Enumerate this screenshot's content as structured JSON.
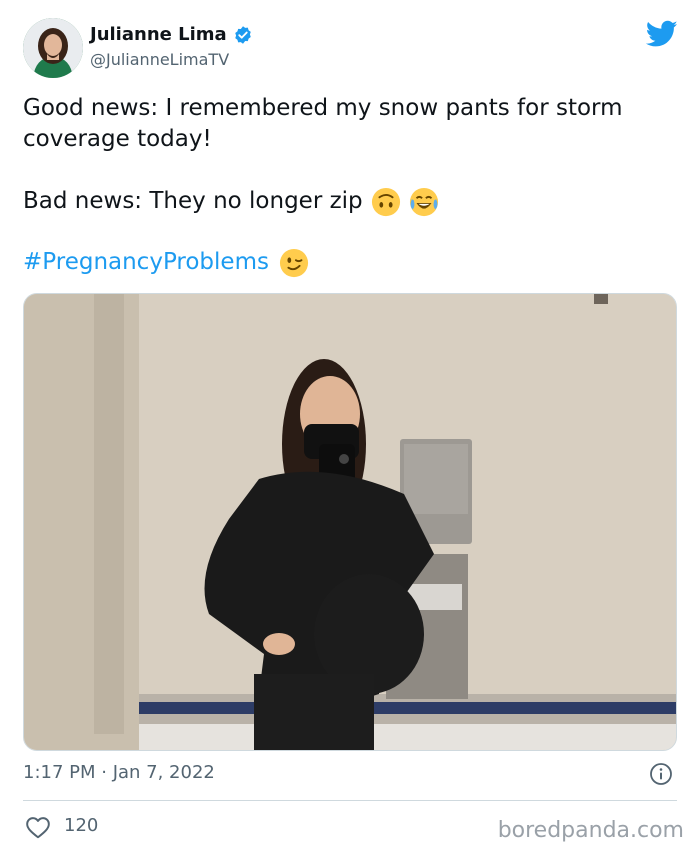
{
  "author": {
    "name": "Julianne Lima",
    "handle": "@JulianneLimaTV",
    "verified": true
  },
  "tweet": {
    "line1": "Good news: I remembered my snow pants for storm coverage today!",
    "line2": "Bad news: They no longer zip",
    "line2_emojis": [
      "upside-down-face",
      "face-with-tears-of-joy"
    ],
    "hashtag": "#PregnancyProblems",
    "hashtag_emoji": "winking-face"
  },
  "meta": {
    "timestamp": "1:17 PM · Jan 7, 2022",
    "like_count": "120"
  },
  "watermark": "boredpanda.com",
  "colors": {
    "link": "#1d9bf0",
    "twitter_blue": "#1d9bf0",
    "secondary_text": "#536471"
  }
}
